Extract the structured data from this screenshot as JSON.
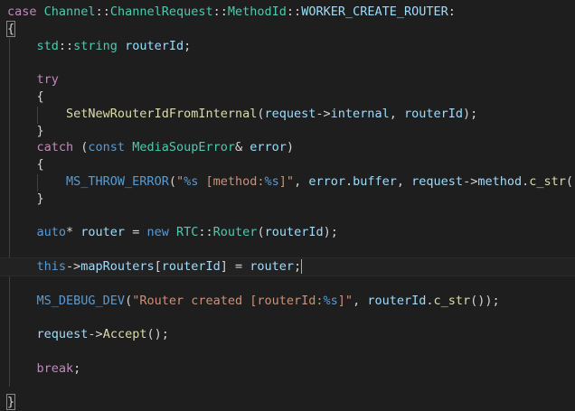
{
  "lines": [
    [
      {
        "t": "case",
        "c": "case-kw"
      },
      {
        "t": " ",
        "c": "punc"
      },
      {
        "t": "Channel",
        "c": "type"
      },
      {
        "t": "::",
        "c": "punc"
      },
      {
        "t": "ChannelRequest",
        "c": "type"
      },
      {
        "t": "::",
        "c": "punc"
      },
      {
        "t": "MethodId",
        "c": "type"
      },
      {
        "t": "::",
        "c": "punc"
      },
      {
        "t": "WORKER_CREATE_ROUTER",
        "c": "var"
      },
      {
        "t": ":",
        "c": "punc"
      }
    ],
    [
      {
        "t": "{",
        "c": "punc",
        "b": true
      }
    ],
    [
      {
        "t": "    ",
        "c": "punc"
      },
      {
        "t": "std",
        "c": "type"
      },
      {
        "t": "::",
        "c": "punc"
      },
      {
        "t": "string",
        "c": "type"
      },
      {
        "t": " ",
        "c": "punc"
      },
      {
        "t": "routerId",
        "c": "var"
      },
      {
        "t": ";",
        "c": "punc"
      }
    ],
    [],
    [
      {
        "t": "    ",
        "c": "punc"
      },
      {
        "t": "try",
        "c": "ctl"
      }
    ],
    [
      {
        "t": "    ",
        "c": "punc"
      },
      {
        "t": "{",
        "c": "punc"
      }
    ],
    [
      {
        "t": "        ",
        "c": "punc"
      },
      {
        "t": "SetNewRouterIdFromInternal",
        "c": "fn"
      },
      {
        "t": "(",
        "c": "punc"
      },
      {
        "t": "request",
        "c": "var"
      },
      {
        "t": "->",
        "c": "punc"
      },
      {
        "t": "internal",
        "c": "var"
      },
      {
        "t": ", ",
        "c": "punc"
      },
      {
        "t": "routerId",
        "c": "var"
      },
      {
        "t": ");",
        "c": "punc"
      }
    ],
    [
      {
        "t": "    ",
        "c": "punc"
      },
      {
        "t": "}",
        "c": "punc"
      }
    ],
    [
      {
        "t": "    ",
        "c": "punc"
      },
      {
        "t": "catch",
        "c": "ctl"
      },
      {
        "t": " (",
        "c": "punc"
      },
      {
        "t": "const",
        "c": "kw"
      },
      {
        "t": " ",
        "c": "punc"
      },
      {
        "t": "MediaSoupError",
        "c": "type"
      },
      {
        "t": "& ",
        "c": "punc"
      },
      {
        "t": "error",
        "c": "var"
      },
      {
        "t": ")",
        "c": "punc"
      }
    ],
    [
      {
        "t": "    ",
        "c": "punc"
      },
      {
        "t": "{",
        "c": "punc"
      }
    ],
    [
      {
        "t": "        ",
        "c": "punc"
      },
      {
        "t": "MS_THROW_ERROR",
        "c": "mac"
      },
      {
        "t": "(",
        "c": "punc"
      },
      {
        "t": "\"",
        "c": "str"
      },
      {
        "t": "%s",
        "c": "kw"
      },
      {
        "t": " [method:",
        "c": "str"
      },
      {
        "t": "%s",
        "c": "kw"
      },
      {
        "t": "]\"",
        "c": "str"
      },
      {
        "t": ", ",
        "c": "punc"
      },
      {
        "t": "error",
        "c": "var"
      },
      {
        "t": ".",
        "c": "punc"
      },
      {
        "t": "buffer",
        "c": "var"
      },
      {
        "t": ", ",
        "c": "punc"
      },
      {
        "t": "request",
        "c": "var"
      },
      {
        "t": "->",
        "c": "punc"
      },
      {
        "t": "method",
        "c": "var"
      },
      {
        "t": ".",
        "c": "punc"
      },
      {
        "t": "c_str",
        "c": "fn"
      },
      {
        "t": "());",
        "c": "punc"
      }
    ],
    [
      {
        "t": "    ",
        "c": "punc"
      },
      {
        "t": "}",
        "c": "punc"
      }
    ],
    [],
    [
      {
        "t": "    ",
        "c": "punc"
      },
      {
        "t": "auto",
        "c": "kw"
      },
      {
        "t": "* ",
        "c": "punc"
      },
      {
        "t": "router",
        "c": "var"
      },
      {
        "t": " = ",
        "c": "punc"
      },
      {
        "t": "new",
        "c": "kw"
      },
      {
        "t": " ",
        "c": "punc"
      },
      {
        "t": "RTC",
        "c": "type"
      },
      {
        "t": "::",
        "c": "punc"
      },
      {
        "t": "Router",
        "c": "type"
      },
      {
        "t": "(",
        "c": "punc"
      },
      {
        "t": "routerId",
        "c": "var"
      },
      {
        "t": ");",
        "c": "punc"
      }
    ],
    [],
    [
      {
        "t": "    ",
        "c": "punc"
      },
      {
        "t": "this",
        "c": "kw"
      },
      {
        "t": "->",
        "c": "punc"
      },
      {
        "t": "mapRouters",
        "c": "var"
      },
      {
        "t": "[",
        "c": "punc"
      },
      {
        "t": "routerId",
        "c": "var"
      },
      {
        "t": "] = ",
        "c": "punc"
      },
      {
        "t": "router",
        "c": "var"
      },
      {
        "t": ";",
        "c": "punc"
      }
    ],
    [],
    [
      {
        "t": "    ",
        "c": "punc"
      },
      {
        "t": "MS_DEBUG_DEV",
        "c": "mac"
      },
      {
        "t": "(",
        "c": "punc"
      },
      {
        "t": "\"Router created [routerId:",
        "c": "str"
      },
      {
        "t": "%s",
        "c": "kw"
      },
      {
        "t": "]\"",
        "c": "str"
      },
      {
        "t": ", ",
        "c": "punc"
      },
      {
        "t": "routerId",
        "c": "var"
      },
      {
        "t": ".",
        "c": "punc"
      },
      {
        "t": "c_str",
        "c": "fn"
      },
      {
        "t": "());",
        "c": "punc"
      }
    ],
    [],
    [
      {
        "t": "    ",
        "c": "punc"
      },
      {
        "t": "request",
        "c": "var"
      },
      {
        "t": "->",
        "c": "punc"
      },
      {
        "t": "Accept",
        "c": "fn"
      },
      {
        "t": "();",
        "c": "punc"
      }
    ],
    [],
    [
      {
        "t": "    ",
        "c": "punc"
      },
      {
        "t": "break",
        "c": "ctl"
      },
      {
        "t": ";",
        "c": "punc"
      }
    ],
    [],
    [
      {
        "t": "}",
        "c": "punc",
        "b": true
      }
    ]
  ],
  "active_line": 15,
  "colors": {
    "background": "#1e1e1e",
    "keyword": "#569cd6",
    "control": "#c586c0",
    "type": "#4ec9b0",
    "function": "#dcdcaa",
    "variable": "#9cdcfe",
    "string": "#ce9178",
    "text": "#d4d4d4"
  }
}
